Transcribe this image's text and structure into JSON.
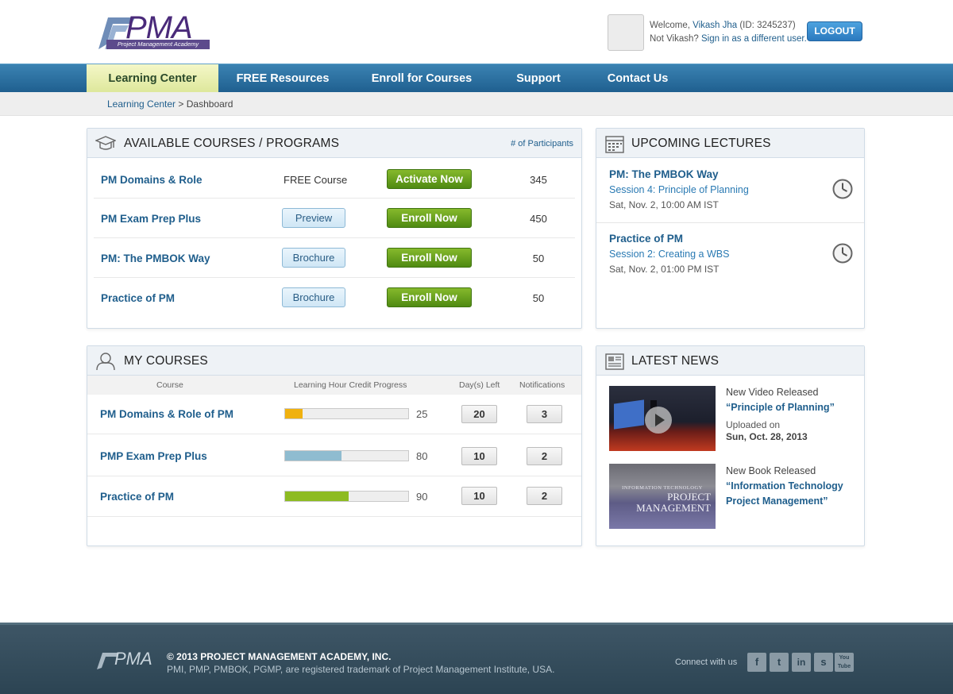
{
  "header": {
    "logo_text": "PMA",
    "logo_subtitle": "Project Management Academy",
    "welcome_prefix": "Welcome, ",
    "user_name": "Vikash Jha",
    "user_id": " (ID: 3245237)",
    "not_user": "Not Vikash? ",
    "switch_user": "Sign in as a different user.",
    "logout_label": "LOGOUT"
  },
  "nav": {
    "items": [
      {
        "label": "Learning Center",
        "active": true
      },
      {
        "label": "FREE Resources"
      },
      {
        "label": "Enroll for Courses"
      },
      {
        "label": "Support"
      },
      {
        "label": "Contact Us"
      }
    ]
  },
  "breadcrumb": {
    "root": "Learning Center",
    "separator": " > ",
    "current": "Dashboard"
  },
  "available": {
    "title": "AVAILABLE COURSES / PROGRAMS",
    "participants_label": "# of Participants",
    "rows": [
      {
        "name": "PM Domains & Role",
        "label": "FREE Course",
        "action": "Activate Now",
        "count": "345"
      },
      {
        "name": "PM Exam Prep Plus",
        "secondary": "Preview",
        "action": "Enroll Now",
        "count": "450"
      },
      {
        "name": "PM: The PMBOK Way",
        "secondary": "Brochure",
        "action": "Enroll Now",
        "count": "50"
      },
      {
        "name": "Practice of PM",
        "secondary": "Brochure",
        "action": "Enroll Now",
        "count": "50"
      }
    ]
  },
  "lectures": {
    "title": "UPCOMING LECTURES",
    "items": [
      {
        "course": "PM: The PMBOK Way",
        "session": "Session 4: Principle of Planning",
        "time": "Sat, Nov. 2, 10:00 AM IST"
      },
      {
        "course": "Practice of PM",
        "session": "Session 2: Creating a WBS",
        "time": "Sat, Nov. 2, 01:00 PM IST"
      }
    ]
  },
  "my_courses": {
    "title": "MY COURSES",
    "columns": [
      "Course",
      "Learning Hour Credit Progress",
      "Day(s) Left",
      "Notifications"
    ],
    "rows": [
      {
        "name": "PM Domains & Role of PM",
        "progress": 25,
        "progress_label": "25",
        "color": "#f0b10f",
        "days": "20",
        "notifications": "3"
      },
      {
        "name": "PMP Exam Prep Plus",
        "progress": 80,
        "progress_label": "80",
        "color": "#8fbcd0",
        "days": "10",
        "notifications": "2"
      },
      {
        "name": "Practice of PM",
        "progress": 90,
        "progress_label": "90",
        "color": "#8dbb22",
        "days": "10",
        "notifications": "2"
      }
    ]
  },
  "news": {
    "title": "LATEST NEWS",
    "items": [
      {
        "kind": "New Video Released",
        "title": "“Principle of Planning”",
        "meta": "Uploaded on",
        "date": "Sun, Oct. 28, 2013"
      },
      {
        "kind": "New Book Released",
        "title": "“Information Technology Project Management”",
        "book_top": "INFORMATION TECHNOLOGY",
        "book_line1": "PROJECT",
        "book_line2": "MANAGEMENT"
      }
    ]
  },
  "footer": {
    "logo_text": "PMA",
    "copyright": "© 2013 PROJECT MANAGEMENT ACADEMY, INC.",
    "trademark": "PMI, PMP, PMBOK, PGMP, are registered trademark of Project Management Institute, USA.",
    "connect": "Connect with us",
    "social": [
      "f",
      "t",
      "in",
      "s",
      "You Tube"
    ]
  }
}
